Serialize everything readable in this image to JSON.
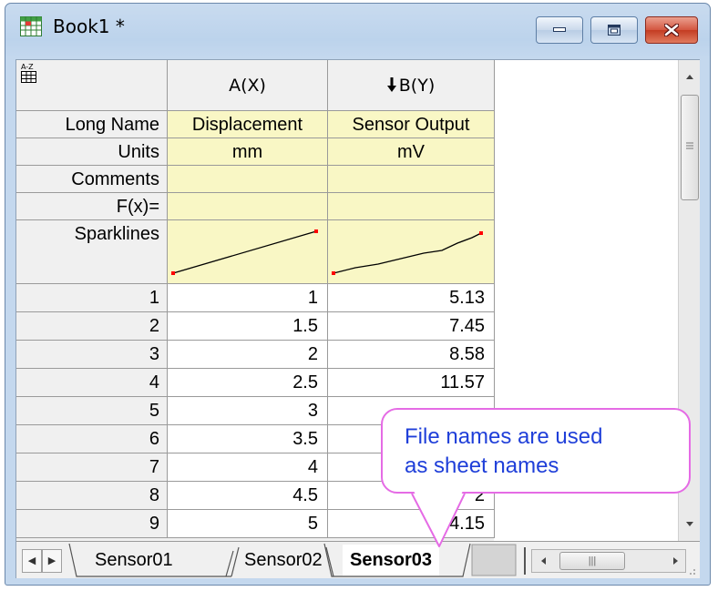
{
  "window": {
    "title": "Book1 *"
  },
  "columns": [
    {
      "header": "A(X)",
      "long_name": "Displacement",
      "units": "mm",
      "comments": "",
      "fx": ""
    },
    {
      "header": "B(Y)",
      "long_name": "Sensor Output",
      "units": "mV",
      "comments": "",
      "fx": ""
    }
  ],
  "row_labels": {
    "long_name": "Long Name",
    "units": "Units",
    "comments": "Comments",
    "fx": "F(x)=",
    "sparklines": "Sparklines"
  },
  "rows": [
    {
      "n": "1",
      "a": "1",
      "b": "5.13"
    },
    {
      "n": "2",
      "a": "1.5",
      "b": "7.45"
    },
    {
      "n": "3",
      "a": "2",
      "b": "8.58"
    },
    {
      "n": "4",
      "a": "2.5",
      "b": "11.57"
    },
    {
      "n": "5",
      "a": "3",
      "b": ""
    },
    {
      "n": "6",
      "a": "3.5",
      "b": ""
    },
    {
      "n": "7",
      "a": "4",
      "b": ""
    },
    {
      "n": "8",
      "a": "4.5",
      "b": "2"
    },
    {
      "n": "9",
      "a": "5",
      "b": "4.15"
    }
  ],
  "sheet_tabs": [
    {
      "label": "Sensor01",
      "active": false
    },
    {
      "label": "Sensor02",
      "active": false
    },
    {
      "label": "Sensor03",
      "active": true
    }
  ],
  "callout": {
    "text": "File names are used\nas sheet names"
  },
  "colors": {
    "metadata_fill": "#f9f7c5",
    "callout_border": "#e56be5",
    "callout_text": "#1f3fd9",
    "sparkline_endpoint": "#ff0000"
  },
  "icons": {
    "app": "worksheet-icon",
    "sort": "sort-az-icon",
    "sort_indicator": "down-arrow-icon"
  }
}
